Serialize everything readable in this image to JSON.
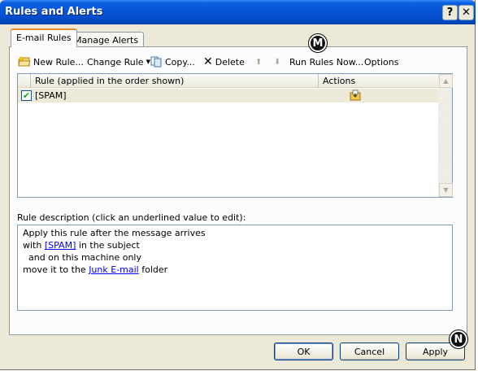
{
  "window": {
    "title": "Rules and Alerts",
    "help_label": "?",
    "close_label": "✕"
  },
  "tabs": [
    {
      "label": "E-mail Rules",
      "active": true
    },
    {
      "label": "Manage Alerts",
      "active": false
    }
  ],
  "toolbar": {
    "new_rule": "New Rule...",
    "change_rule": "Change Rule",
    "copy": "Copy...",
    "delete": "Delete",
    "move_up_icon": "arrow-up-icon",
    "move_down_icon": "arrow-down-icon",
    "run_rules_now": "Run Rules Now...",
    "options": "Options"
  },
  "rules_list": {
    "columns": [
      "Rule (applied in the order shown)",
      "Actions"
    ],
    "rows": [
      {
        "checked": true,
        "name": "[SPAM]",
        "action_icon": "move-to-folder-icon"
      }
    ]
  },
  "description": {
    "label": "Rule description (click an underlined value to edit):",
    "line1": "Apply this rule after the message arrives",
    "line2_prefix": "with ",
    "line2_link": "[SPAM]",
    "line2_suffix": " in the subject",
    "line3": "  and on this machine only",
    "line4_prefix": "move it to the ",
    "line4_link": "Junk E-mail",
    "line4_suffix": " folder"
  },
  "buttons": {
    "ok": "OK",
    "cancel": "Cancel",
    "apply": "Apply"
  },
  "badges": {
    "m": "M",
    "n": "N"
  },
  "colors": {
    "titlebar": "#0554d6",
    "dialog_bg": "#ece9d8",
    "link": "#0000ee",
    "selected_row": "#ece9d8"
  }
}
